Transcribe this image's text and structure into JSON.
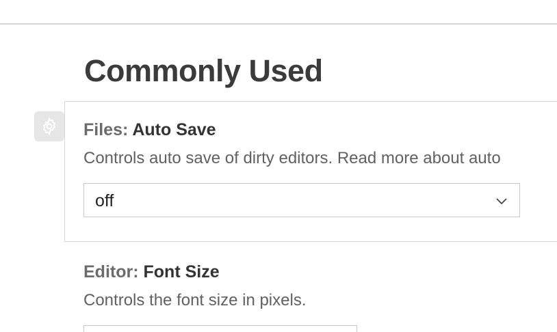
{
  "section": {
    "title": "Commonly Used"
  },
  "settings": [
    {
      "category": "Files: ",
      "name": "Auto Save",
      "description": "Controls auto save of dirty editors. Read more about auto",
      "control": {
        "type": "select",
        "value": "off",
        "icon": "chevron-down-icon"
      },
      "gear_icon": "gear-icon"
    },
    {
      "category": "Editor: ",
      "name": "Font Size",
      "description": "Controls the font size in pixels.",
      "control": {
        "type": "number-input"
      }
    }
  ],
  "colors": {
    "card_border": "#d8d8d8",
    "gear_background": "#e6e6e6",
    "title_text": "#3b3b3b",
    "description_text": "#616161",
    "category_text": "#6b6b6b"
  }
}
